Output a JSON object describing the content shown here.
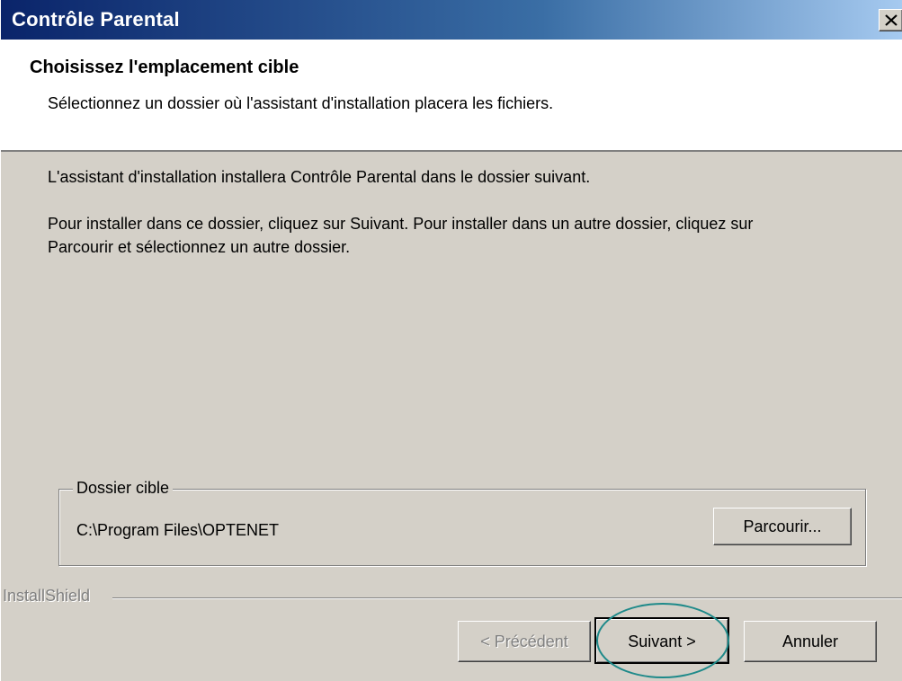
{
  "window": {
    "title": "Contrôle Parental"
  },
  "header": {
    "title": "Choisissez l'emplacement cible",
    "description": "Sélectionnez un dossier où l'assistant d'installation placera les fichiers."
  },
  "body": {
    "line1": "L'assistant d'installation installera Contrôle Parental dans le dossier suivant.",
    "line2": "Pour installer dans ce dossier, cliquez sur Suivant. Pour installer dans un autre dossier, cliquez sur Parcourir et sélectionnez un autre dossier."
  },
  "destination": {
    "group_label": "Dossier cible",
    "path": "C:\\Program Files\\OPTENET",
    "browse_label": "Parcourir..."
  },
  "footer": {
    "brand": "InstallShield",
    "back_label": "< Précédent",
    "next_label": "Suivant >",
    "cancel_label": "Annuler"
  },
  "icons": {
    "close": "close-icon"
  },
  "colors": {
    "titlebar_start": "#0a246a",
    "titlebar_end": "#a6caf0",
    "dialog_bg": "#d4d0c8",
    "highlight": "#1f8a8a"
  }
}
